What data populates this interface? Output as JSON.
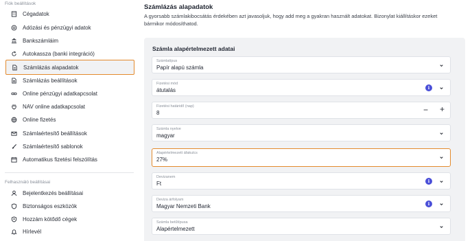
{
  "sidebar": {
    "section1_label": "Fiók beállítások",
    "items1": [
      {
        "label": "Cégadatok",
        "icon": "building-icon"
      },
      {
        "label": "Adózási és pénzügyi adatok",
        "icon": "coin-icon"
      },
      {
        "label": "Bankszámláim",
        "icon": "bank-icon"
      },
      {
        "label": "Autokassza (banki integráció)",
        "icon": "refresh-icon"
      },
      {
        "label": "Számlázás alapadatok",
        "icon": "document-icon"
      },
      {
        "label": "Számlázás beállítások",
        "icon": "document-settings-icon"
      },
      {
        "label": "Online pénzügyi adatkapcsolat",
        "icon": "link-icon"
      },
      {
        "label": "NAV online adatkapcsolat",
        "icon": "plug-icon"
      },
      {
        "label": "Online fizetés",
        "icon": "globe-icon"
      },
      {
        "label": "Számlaértesítő beállítások",
        "icon": "mail-icon"
      },
      {
        "label": "Számlaértesítő sablonok",
        "icon": "brush-icon"
      },
      {
        "label": "Automatikus fizetési felszólítás",
        "icon": "calendar-icon"
      }
    ],
    "section2_label": "Felhasználó beállításai",
    "items2": [
      {
        "label": "Bejelentkezés beállításai",
        "icon": "user-icon"
      },
      {
        "label": "Biztonságos eszközök",
        "icon": "shield-icon"
      },
      {
        "label": "Hozzám kötődő cégek",
        "icon": "shield-user-icon"
      },
      {
        "label": "Hírlevél",
        "icon": "bell-icon"
      }
    ]
  },
  "main": {
    "title": "Számlázás alapadatok",
    "description": "A gyorsabb számlakibocsátás érdekében azt javasoljuk, hogy add meg a gyakran használt adatokat. Bizonylat kiállításkor ezeket bármikor módosíthatod.",
    "panel_title": "Számla alapértelmezett adatai",
    "fields": [
      {
        "label": "Számlatípus",
        "value": "Papír alapú számla"
      },
      {
        "label": "Fizetési mód",
        "value": "átutalás"
      },
      {
        "label": "Fizetési határidő (nap)",
        "value": "8",
        "minus": "−",
        "plus": "+"
      },
      {
        "label": "Számla nyelve",
        "value": "magyar"
      },
      {
        "label": "Alapértelmezett áfakulcs",
        "value": "27%"
      },
      {
        "label": "Devizanem",
        "value": "Ft"
      },
      {
        "label": "Deviza árfolyam",
        "value": "Magyar Nemzeti Bank"
      },
      {
        "label": "Számla betűtípusa",
        "value": "Alapértelmezett"
      }
    ],
    "info_glyph": "i"
  },
  "colors": {
    "accent_orange": "#e38a2c",
    "info_blue": "#4a4fd8",
    "panel_bg": "#f1f2f4"
  }
}
